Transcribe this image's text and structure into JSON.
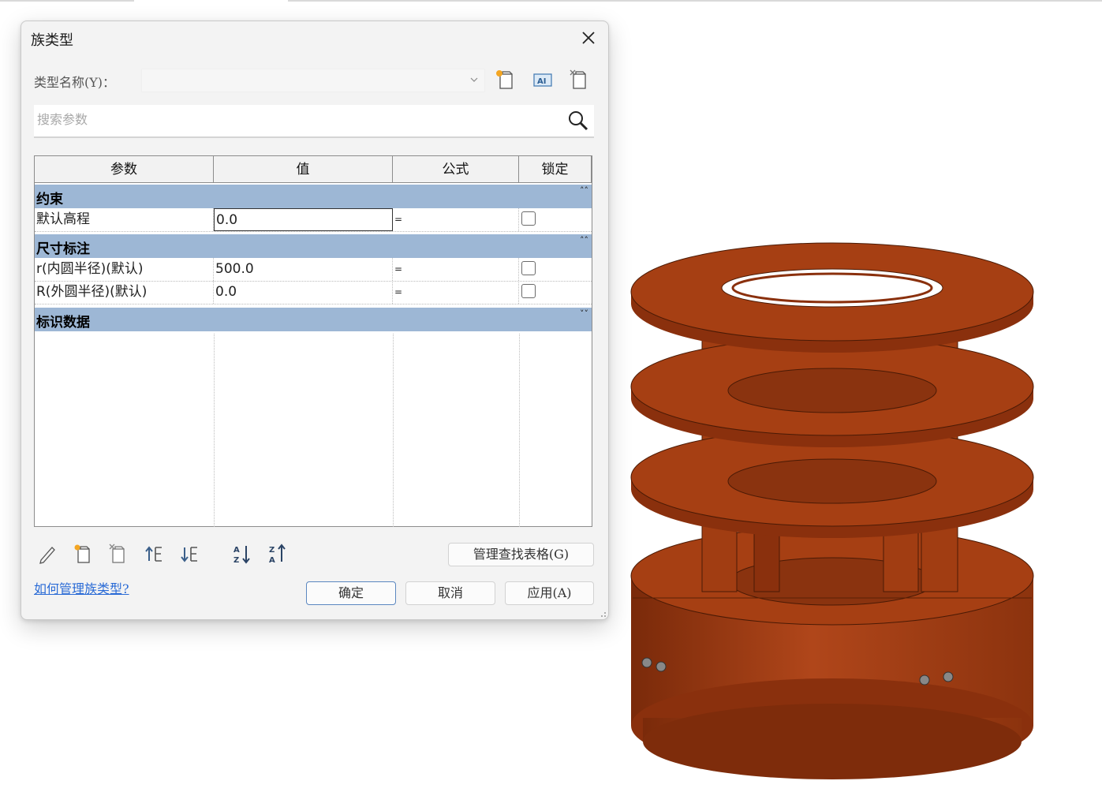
{
  "dialog": {
    "title": "族类型",
    "type_name_label": "类型名称(Y)：",
    "type_name_value": "",
    "search_placeholder": "搜索参数",
    "columns": [
      "参数",
      "值",
      "公式",
      "锁定"
    ],
    "groups": [
      {
        "name": "约束",
        "rows": [
          {
            "param": "默认高程",
            "value": "0.0",
            "formula": "=",
            "locked": false
          }
        ]
      },
      {
        "name": "尺寸标注",
        "rows": [
          {
            "param": "r(内圆半径)(默认)",
            "value": "500.0",
            "formula": "=",
            "locked": false
          },
          {
            "param": "R(外圆半径)(默认)",
            "value": "0.0",
            "formula": "=",
            "locked": false
          }
        ]
      },
      {
        "name": "标识数据",
        "rows": []
      }
    ],
    "manage_lookup_label": "管理查找表格(G)",
    "help_link": "如何管理族类型?",
    "ok_label": "确定",
    "cancel_label": "取消",
    "apply_label": "应用(A)",
    "top_icons": [
      "new-type-icon",
      "rename-type-icon",
      "delete-type-icon"
    ],
    "bottom_icons": [
      "edit-parameter-icon",
      "new-parameter-icon",
      "delete-parameter-icon",
      "move-up-icon",
      "move-down-icon",
      "sort-ascending-icon",
      "sort-descending-icon"
    ]
  },
  "colors": {
    "group_header": "#9db7d5",
    "model_fill": "#a73f12",
    "link": "#2a6bd6"
  }
}
